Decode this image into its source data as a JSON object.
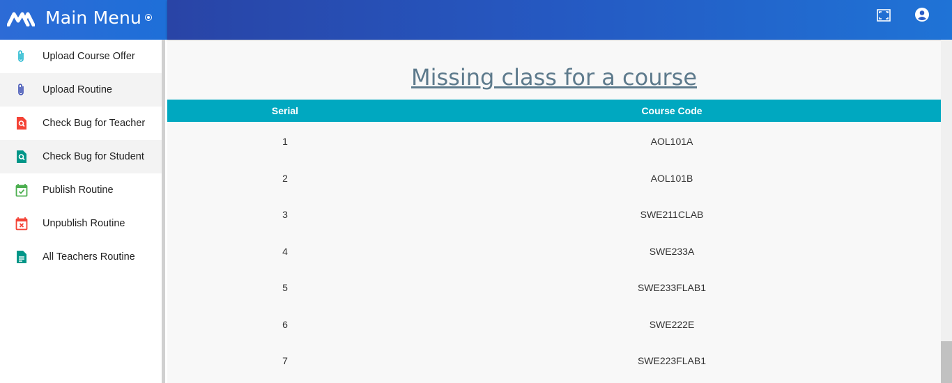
{
  "app": {
    "title": "Main Menu"
  },
  "sidebar": {
    "items": [
      {
        "label": "Upload Course Offer",
        "icon": "paperclip-icon",
        "color": "#20b7cf"
      },
      {
        "label": "Upload Routine",
        "icon": "paperclip-icon",
        "color": "#3f51b5"
      },
      {
        "label": "Check Bug for Teacher",
        "icon": "file-search-icon",
        "color": "#f44336"
      },
      {
        "label": "Check Bug for Student",
        "icon": "file-search-icon",
        "color": "#009688"
      },
      {
        "label": "Publish Routine",
        "icon": "calendar-check-icon",
        "color": "#4caf50"
      },
      {
        "label": "Unpublish Routine",
        "icon": "calendar-remove-icon",
        "color": "#f44336"
      },
      {
        "label": "All Teachers Routine",
        "icon": "file-document-icon",
        "color": "#009688"
      }
    ]
  },
  "main": {
    "title": "Missing class for a course",
    "table": {
      "headers": [
        "Serial",
        "Course Code"
      ],
      "rows": [
        [
          "1",
          "AOL101A"
        ],
        [
          "2",
          "AOL101B"
        ],
        [
          "3",
          "SWE211CLAB"
        ],
        [
          "4",
          "SWE233A"
        ],
        [
          "5",
          "SWE233FLAB1"
        ],
        [
          "6",
          "SWE222E"
        ],
        [
          "7",
          "SWE223FLAB1"
        ]
      ]
    }
  },
  "colors": {
    "header_accent": "#00a8c0",
    "topbar": "#2559c2"
  }
}
